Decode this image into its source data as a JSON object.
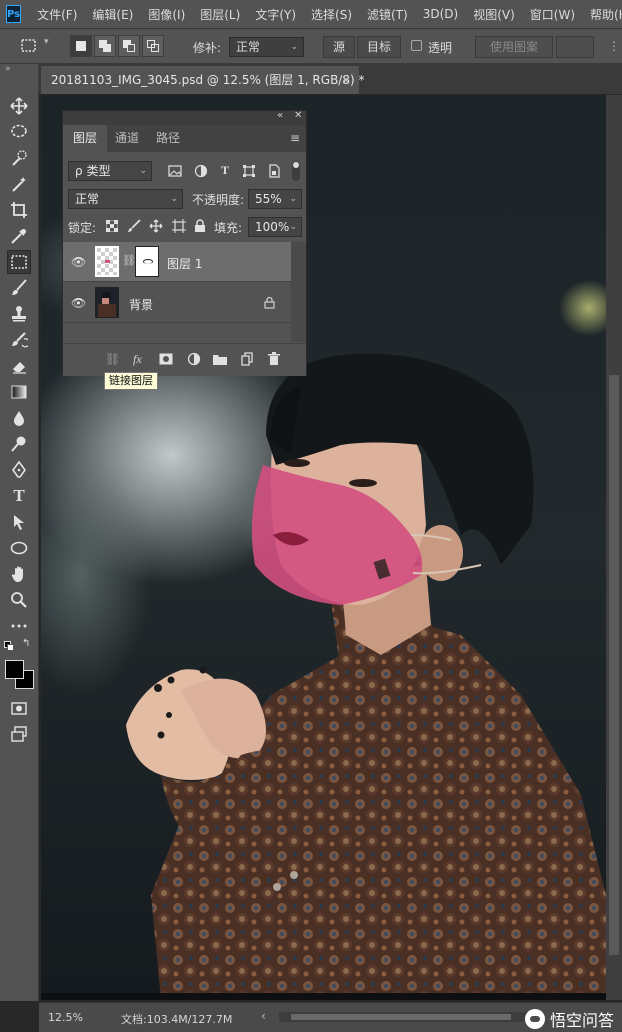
{
  "app": {
    "logo": "Ps"
  },
  "menu": [
    "文件(F)",
    "编辑(E)",
    "图像(I)",
    "图层(L)",
    "文字(Y)",
    "选择(S)",
    "滤镜(T)",
    "3D(D)",
    "视图(V)",
    "窗口(W)",
    "帮助(H)"
  ],
  "options_bar": {
    "repair_label": "修补:",
    "mode_value": "正常",
    "source_label": "源",
    "target_label": "目标",
    "transparent_label": "透明",
    "use_pattern_label": "使用图案"
  },
  "tools": [
    "move-icon",
    "lasso-icon",
    "quick-select-icon",
    "crop-icon",
    "eyedropper-icon",
    "patch-icon",
    "brush-icon",
    "stamp-icon",
    "history-brush-icon",
    "eraser-icon",
    "gradient-icon",
    "blur-icon",
    "dodge-icon",
    "pen-icon",
    "type-icon",
    "path-select-icon",
    "ellipse-icon",
    "hand-icon",
    "zoom-icon",
    "more-icon"
  ],
  "type_tool_glyph": "T",
  "document": {
    "tab_title": "20181103_IMG_3045.psd @ 12.5% (图层 1, RGB/8) *",
    "close_glyph": "×"
  },
  "layers_panel": {
    "tabs": [
      "图层",
      "通道",
      "路径"
    ],
    "filter_label": "类型",
    "filter_prefix": "ρ",
    "blend_mode": "正常",
    "opacity_label": "不透明度:",
    "opacity_value": "55%",
    "lock_label": "锁定:",
    "fill_label": "填充:",
    "fill_value": "100%",
    "layers": [
      {
        "name": "图层 1",
        "selected": true
      },
      {
        "name": "背景",
        "selected": false
      }
    ],
    "fx_label": "fx"
  },
  "tooltip": "链接图层",
  "status": {
    "zoom": "12.5%",
    "doc_size": "文档:103.4M/127.7M"
  },
  "watermark": "悟空问答",
  "colors": {
    "mask_pink": "#d24f7f",
    "panel_bg": "#535353",
    "canvas_bg": "#1c2329"
  }
}
